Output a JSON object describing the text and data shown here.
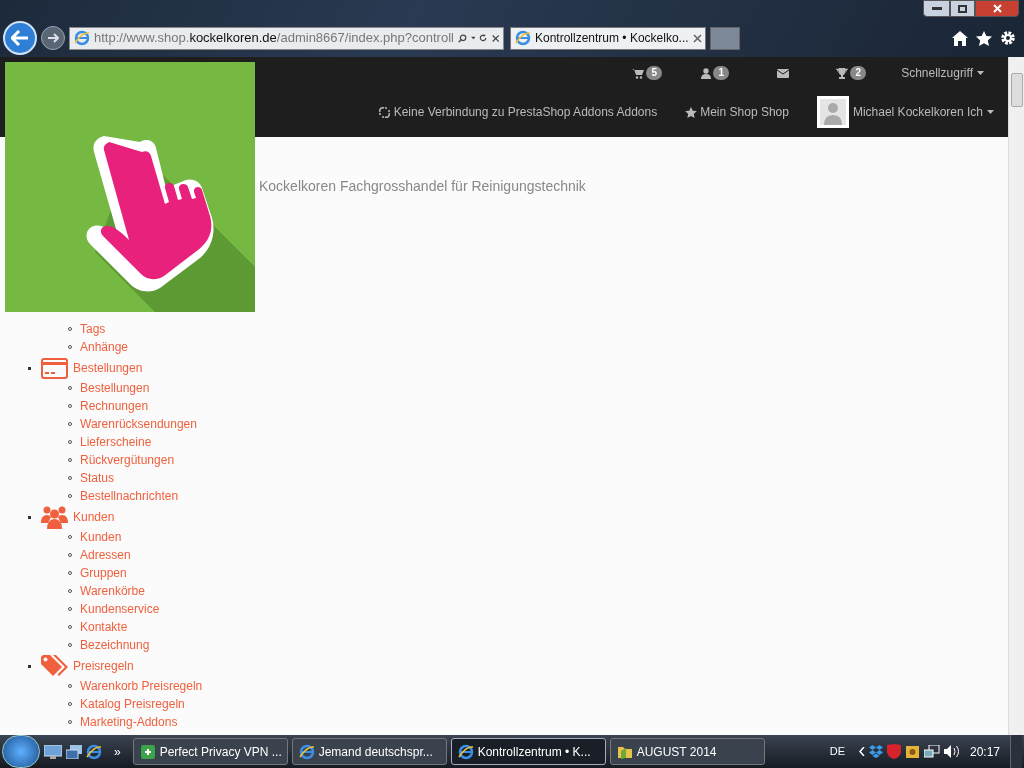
{
  "browser": {
    "address": "http://www.shop.**kockelkoren.de**/admin8667/index.php?controll",
    "tabs": [
      {
        "label": "Kontrollzentrum • Kockelko...",
        "selected": true
      }
    ]
  },
  "header": {
    "notifications": [
      {
        "kind": "cart",
        "count": "5"
      },
      {
        "kind": "user",
        "count": "1"
      },
      {
        "kind": "mail"
      },
      {
        "kind": "trophy",
        "count": "2"
      }
    ],
    "quick_access": "Schnellzugriff",
    "addons_status": "Keine Verbindung zu PrestaShop Addons Addons",
    "my_shop": "Mein Shop Shop",
    "employee": "Michael Kockelkoren Ich"
  },
  "shop_name": "Kockelkoren Fachgrosshandel für Reinigungstechnik",
  "menu": [
    {
      "children": [
        "Tags",
        "Anhänge"
      ]
    },
    {
      "kind": "orders",
      "label": "Bestellungen",
      "children": [
        "Bestellungen",
        "Rechnungen",
        "Warenrücksendungen",
        "Lieferscheine",
        "Rückvergütungen",
        "Status",
        "Bestellnachrichten"
      ]
    },
    {
      "kind": "customers",
      "label": "Kunden",
      "children": [
        "Kunden",
        "Adressen",
        "Gruppen",
        "Warenkörbe",
        "Kundenservice",
        "Kontakte",
        "Bezeichnung"
      ]
    },
    {
      "kind": "price_rules",
      "label": "Preisregeln",
      "children": [
        "Warenkorb Preisregeln",
        "Katalog Preisregeln",
        "Marketing-Addons"
      ]
    }
  ],
  "taskbar": {
    "items": [
      {
        "kind": "vpn",
        "label": "Perfect Privacy VPN ...",
        "selected": false
      },
      {
        "kind": "ie",
        "label": "Jemand deutschspr...",
        "selected": false
      },
      {
        "kind": "ie",
        "label": "Kontrollzentrum • K...",
        "selected": true
      },
      {
        "kind": "folder",
        "label": "AUGUST 2014",
        "selected": false
      }
    ],
    "overflow": "»",
    "language": "DE",
    "time": "20:17"
  }
}
